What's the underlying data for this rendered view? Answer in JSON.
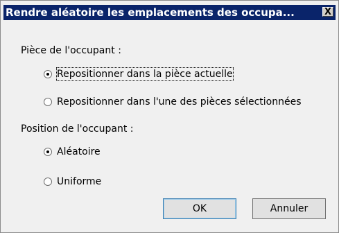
{
  "window": {
    "title": "Rendre aléatoire les emplacements des occupa...",
    "close_glyph": "X"
  },
  "group_room": {
    "label": "Pièce de l'occupant :",
    "options": [
      {
        "label": "Repositionner dans la pièce actuelle",
        "selected": true
      },
      {
        "label": "Repositionner dans l'une des pièces sélectionnées",
        "selected": false
      }
    ]
  },
  "group_position": {
    "label": "Position de l'occupant :",
    "options": [
      {
        "label": "Aléatoire",
        "selected": true
      },
      {
        "label": "Uniforme",
        "selected": false
      }
    ]
  },
  "buttons": {
    "ok": "OK",
    "cancel": "Annuler"
  },
  "colors": {
    "titlebar": "#0a246a",
    "background": "#f0f0f0"
  }
}
